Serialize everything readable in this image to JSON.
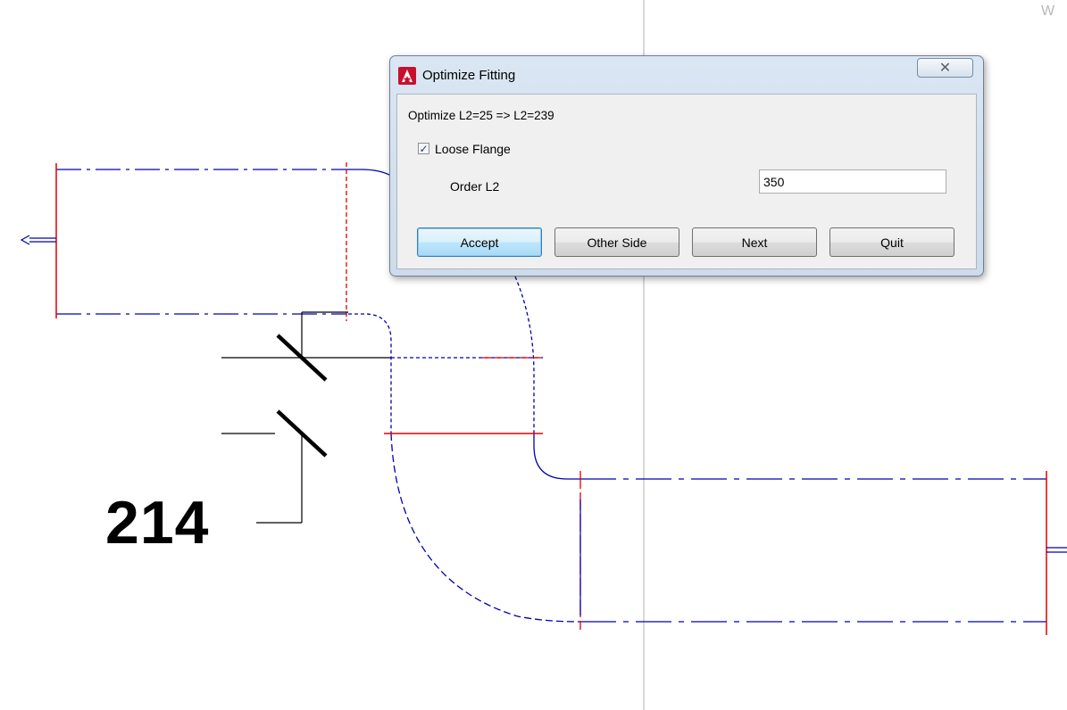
{
  "drawing": {
    "dimension_text": "214",
    "corner_text": "W"
  },
  "dialog": {
    "title": "Optimize Fitting",
    "close_symbol": "✕",
    "info": "Optimize L2=25 => L2=239",
    "checkbox": {
      "label": "Loose Flange",
      "checked": true,
      "mark": "✓"
    },
    "order_label": "Order L2",
    "order_value": "350",
    "buttons": {
      "accept": "Accept",
      "other_side": "Other Side",
      "next": "Next",
      "quit": "Quit"
    }
  },
  "colors": {
    "pipe_line": "#0000b0",
    "flange_line": "#e00000",
    "dim_line": "#000000",
    "crosshair": "#b0b0b0",
    "dialog_frame": "#cddbea",
    "app_icon": "#c8102e"
  }
}
